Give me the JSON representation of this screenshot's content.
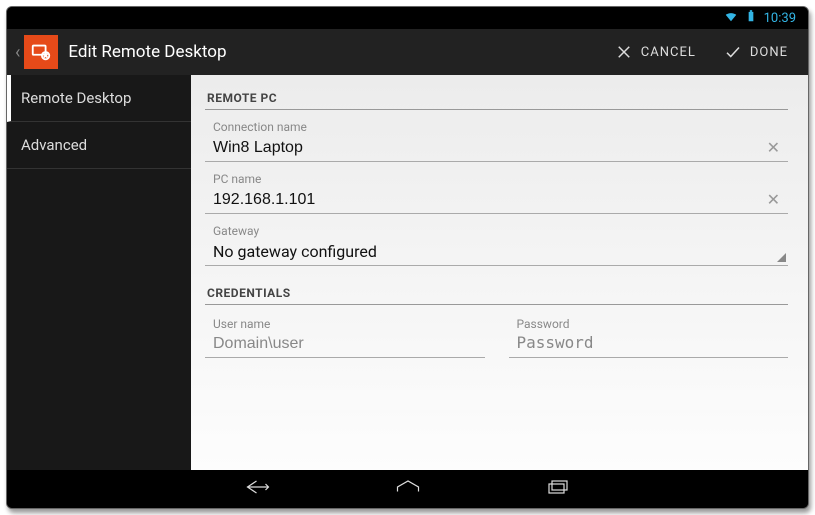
{
  "statusbar": {
    "time": "10:39"
  },
  "actionbar": {
    "title": "Edit Remote Desktop",
    "cancel": "CANCEL",
    "done": "DONE"
  },
  "sidebar": {
    "items": [
      {
        "label": "Remote Desktop",
        "active": true
      },
      {
        "label": "Advanced",
        "active": false
      }
    ]
  },
  "form": {
    "section_remote": "REMOTE PC",
    "connection_name_label": "Connection name",
    "connection_name_value": "Win8 Laptop",
    "pc_name_label": "PC name",
    "pc_name_value": "192.168.1.101",
    "gateway_label": "Gateway",
    "gateway_value": "No gateway configured",
    "section_credentials": "CREDENTIALS",
    "username_label": "User name",
    "username_placeholder": "Domain\\user",
    "username_value": "",
    "password_label": "Password",
    "password_placeholder": "Password",
    "password_value": ""
  }
}
